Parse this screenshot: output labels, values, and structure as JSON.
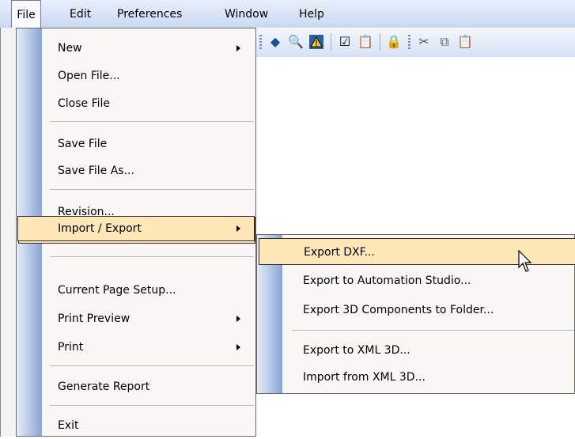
{
  "menubar": {
    "items": [
      {
        "label": "File"
      },
      {
        "label": "Edit"
      },
      {
        "label": "Preferences"
      },
      {
        "label": "Window"
      },
      {
        "label": "Help"
      }
    ]
  },
  "file_menu": {
    "items": [
      {
        "label": "New"
      },
      {
        "label": "Open File..."
      },
      {
        "label": "Close File"
      },
      {
        "label": "Save File"
      },
      {
        "label": "Save File As..."
      },
      {
        "label": "Revision..."
      },
      {
        "label": "Import / Export"
      },
      {
        "label": "Current Page Setup..."
      },
      {
        "label": "Print Preview"
      },
      {
        "label": "Print"
      },
      {
        "label": "Generate Report"
      },
      {
        "label": "Exit"
      }
    ]
  },
  "import_export_menu": {
    "items": [
      {
        "label": "Export DXF..."
      },
      {
        "label": "Export to Automation Studio..."
      },
      {
        "label": "Export 3D Components to Folder..."
      },
      {
        "label": "Export to XML 3D..."
      },
      {
        "label": "Import from XML 3D..."
      }
    ]
  },
  "colors": {
    "highlight": "#ffe7b8",
    "menubar": "#c9d8f1",
    "gutter": "#8aa4d2"
  },
  "toolbar": {
    "icons": [
      "diamond-icon",
      "zoom-icon",
      "warning-icon",
      "checklist-icon",
      "clipboard-icon",
      "lock-icon",
      "cut-icon",
      "copy-icon",
      "paste-icon"
    ]
  }
}
